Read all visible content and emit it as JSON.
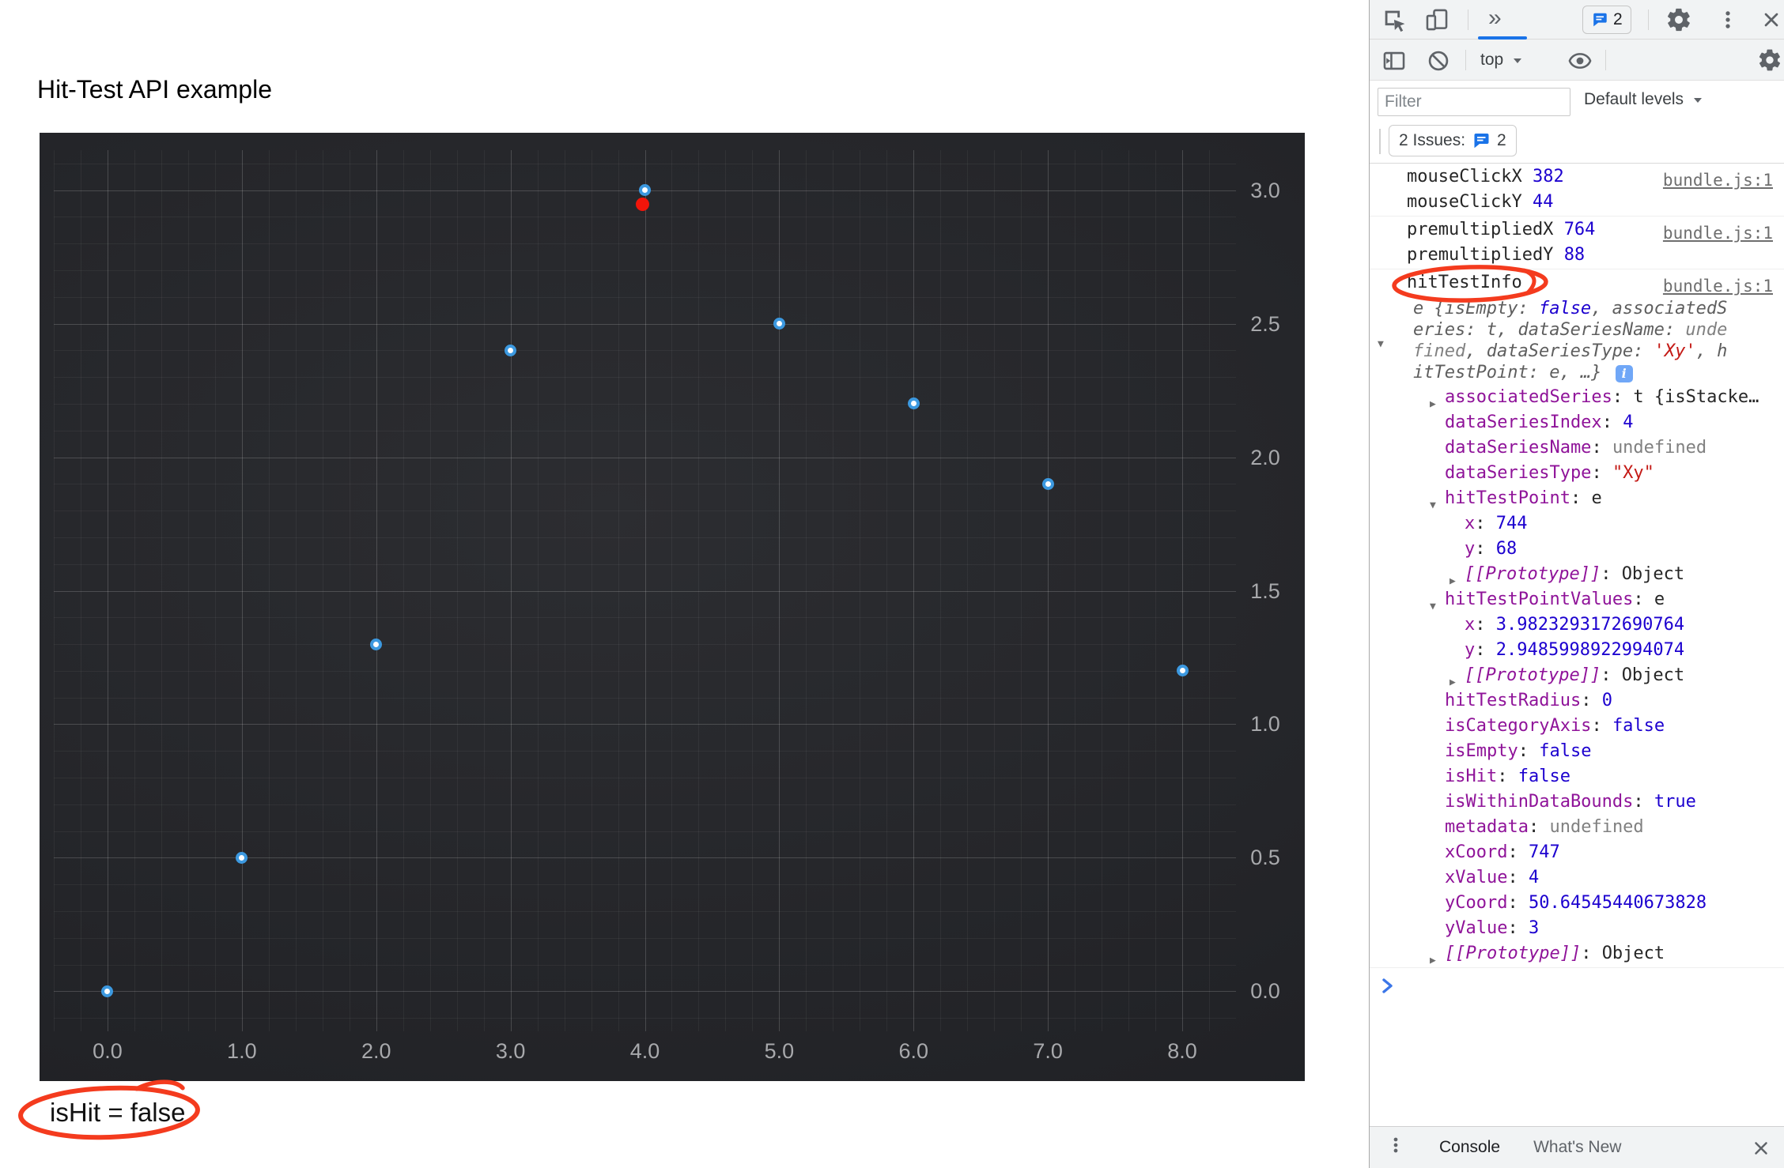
{
  "page": {
    "title": "Hit-Test API example",
    "hit_status": "isHit = false"
  },
  "chart_data": {
    "type": "scatter",
    "title": "",
    "xlabel": "",
    "ylabel": "",
    "x": [
      0,
      1,
      2,
      3,
      4,
      5,
      6,
      7,
      8
    ],
    "y": [
      0,
      0.5,
      1.3,
      2.4,
      3,
      2.5,
      2.2,
      1.9,
      1.2
    ],
    "highlight_point": {
      "x": 3.9823293172690764,
      "y": 2.9485998922994074,
      "color": "#F2150A"
    },
    "marker": {
      "stroke": "#3C99E0",
      "fill": "#FFFFFF"
    },
    "x_ticks": [
      {
        "v": 0,
        "label": "0.0"
      },
      {
        "v": 1,
        "label": "1.0"
      },
      {
        "v": 2,
        "label": "2.0"
      },
      {
        "v": 3,
        "label": "3.0"
      },
      {
        "v": 4,
        "label": "4.0"
      },
      {
        "v": 5,
        "label": "5.0"
      },
      {
        "v": 6,
        "label": "6.0"
      },
      {
        "v": 7,
        "label": "7.0"
      },
      {
        "v": 8,
        "label": "8.0"
      }
    ],
    "y_ticks": [
      {
        "v": 3,
        "label": "3.0"
      },
      {
        "v": 2.5,
        "label": "2.5"
      },
      {
        "v": 2,
        "label": "2.0"
      },
      {
        "v": 1.5,
        "label": "1.5"
      },
      {
        "v": 1,
        "label": "1.0"
      },
      {
        "v": 0.5,
        "label": "0.5"
      },
      {
        "v": 0,
        "label": "0.0"
      }
    ],
    "x_range": [
      -0.4,
      8.4
    ],
    "y_range": [
      -0.15,
      3.15
    ],
    "minor_step": {
      "x": 0.2,
      "y": 0.1
    },
    "grid": "on",
    "legend": "none",
    "colors": {
      "grid_major": "rgba(255,255,255,0.13)",
      "grid_minor": "rgba(255,255,255,0.05)",
      "tick_label": "#A8A9AC"
    }
  },
  "annotation_color": "#F43B1E",
  "devtools": {
    "tabs_row": {
      "more_tabs": "»",
      "issues_count": "2"
    },
    "console_toolbar": {
      "context": "top"
    },
    "filter_row": {
      "placeholder": "Filter",
      "levels": "Default levels"
    },
    "issues_bar": {
      "label": "2 Issues:",
      "count": "2"
    },
    "console": {
      "prompt": ">",
      "entries": [
        {
          "source": "bundle.js:1",
          "rows": [
            {
              "i": "0",
              "seg": [
                [
                  "mouseClickX ",
                  "sp"
                ],
                [
                  "382",
                  "sn"
                ]
              ]
            },
            {
              "i": "0",
              "seg": [
                [
                  "mouseClickY ",
                  "sp"
                ],
                [
                  "44",
                  "sn"
                ]
              ]
            }
          ]
        },
        {
          "source": "bundle.js:1",
          "rows": [
            {
              "i": "0",
              "seg": [
                [
                  "premultipliedX ",
                  "sp"
                ],
                [
                  "764",
                  "sn"
                ]
              ]
            },
            {
              "i": "0",
              "seg": [
                [
                  "premultipliedY ",
                  "sp"
                ],
                [
                  "88",
                  "sn"
                ]
              ]
            }
          ]
        },
        {
          "source": "bundle.js:1",
          "annotated": true,
          "rows": [
            {
              "i": "0",
              "name": "hit-test-info-label",
              "seg": [
                [
                  "hitTestInfo",
                  "sp"
                ]
              ]
            },
            {
              "i": "p",
              "arrow": "v",
              "seg": [
                [
                  "e {isEmpty: ",
                  "sg"
                ],
                [
                  "false",
                  "sb"
                ],
                [
                  ", associatedSeries: ",
                  "sg"
                ],
                [
                  "t",
                  "sg"
                ],
                [
                  ", dataSeriesName: ",
                  "sg"
                ],
                [
                  "undefined",
                  "su"
                ],
                [
                  ", dataSeriesType: ",
                  "sg"
                ],
                [
                  "'Xy'",
                  "ss"
                ],
                [
                  ", hitTestPoint: ",
                  "sg"
                ],
                [
                  "e",
                  "sg"
                ],
                [
                  ", …} ",
                  "sg"
                ],
                [
                  "i",
                  "icon"
                ]
              ]
            },
            {
              "i": "1",
              "arrow": "r",
              "seg": [
                [
                  "associatedSeries",
                  "sk"
                ],
                [
                  ": ",
                  "sp"
                ],
                [
                  "t {isStacke…",
                  "sp"
                ]
              ]
            },
            {
              "i": "1",
              "seg": [
                [
                  "dataSeriesIndex",
                  "sk"
                ],
                [
                  ": ",
                  "sp"
                ],
                [
                  "4",
                  "sn"
                ]
              ]
            },
            {
              "i": "1",
              "seg": [
                [
                  "dataSeriesName",
                  "sk"
                ],
                [
                  ": ",
                  "sp"
                ],
                [
                  "undefined",
                  "su"
                ]
              ]
            },
            {
              "i": "1",
              "seg": [
                [
                  "dataSeriesType",
                  "sk"
                ],
                [
                  ": ",
                  "sp"
                ],
                [
                  "\"Xy\"",
                  "ss"
                ]
              ]
            },
            {
              "i": "1",
              "arrow": "v",
              "seg": [
                [
                  "hitTestPoint",
                  "sk"
                ],
                [
                  ": ",
                  "sp"
                ],
                [
                  "e",
                  "sp"
                ]
              ]
            },
            {
              "i": "2",
              "seg": [
                [
                  "x",
                  "sk"
                ],
                [
                  ": ",
                  "sp"
                ],
                [
                  "744",
                  "sn"
                ]
              ]
            },
            {
              "i": "2",
              "seg": [
                [
                  "y",
                  "sk"
                ],
                [
                  ": ",
                  "sp"
                ],
                [
                  "68",
                  "sn"
                ]
              ]
            },
            {
              "i": "2",
              "arrow": "r",
              "seg": [
                [
                  "[[Prototype]]",
                  "ski"
                ],
                [
                  ": ",
                  "sp"
                ],
                [
                  "Object",
                  "sp"
                ]
              ]
            },
            {
              "i": "1",
              "arrow": "v",
              "seg": [
                [
                  "hitTestPointValues",
                  "sk"
                ],
                [
                  ": ",
                  "sp"
                ],
                [
                  "e",
                  "sp"
                ]
              ]
            },
            {
              "i": "2",
              "seg": [
                [
                  "x",
                  "sk"
                ],
                [
                  ": ",
                  "sp"
                ],
                [
                  "3.9823293172690764",
                  "sn"
                ]
              ]
            },
            {
              "i": "2",
              "seg": [
                [
                  "y",
                  "sk"
                ],
                [
                  ": ",
                  "sp"
                ],
                [
                  "2.9485998922994074",
                  "sn"
                ]
              ]
            },
            {
              "i": "2",
              "arrow": "r",
              "seg": [
                [
                  "[[Prototype]]",
                  "ski"
                ],
                [
                  ": ",
                  "sp"
                ],
                [
                  "Object",
                  "sp"
                ]
              ]
            },
            {
              "i": "1",
              "seg": [
                [
                  "hitTestRadius",
                  "sk"
                ],
                [
                  ": ",
                  "sp"
                ],
                [
                  "0",
                  "sn"
                ]
              ]
            },
            {
              "i": "1",
              "seg": [
                [
                  "isCategoryAxis",
                  "sk"
                ],
                [
                  ": ",
                  "sp"
                ],
                [
                  "false",
                  "sb"
                ]
              ]
            },
            {
              "i": "1",
              "seg": [
                [
                  "isEmpty",
                  "sk"
                ],
                [
                  ": ",
                  "sp"
                ],
                [
                  "false",
                  "sb"
                ]
              ]
            },
            {
              "i": "1",
              "seg": [
                [
                  "isHit",
                  "sk"
                ],
                [
                  ": ",
                  "sp"
                ],
                [
                  "false",
                  "sb"
                ]
              ]
            },
            {
              "i": "1",
              "seg": [
                [
                  "isWithinDataBounds",
                  "sk"
                ],
                [
                  ": ",
                  "sp"
                ],
                [
                  "true",
                  "sb"
                ]
              ]
            },
            {
              "i": "1",
              "seg": [
                [
                  "metadata",
                  "sk"
                ],
                [
                  ": ",
                  "sp"
                ],
                [
                  "undefined",
                  "su"
                ]
              ]
            },
            {
              "i": "1",
              "seg": [
                [
                  "xCoord",
                  "sk"
                ],
                [
                  ": ",
                  "sp"
                ],
                [
                  "747",
                  "sn"
                ]
              ]
            },
            {
              "i": "1",
              "seg": [
                [
                  "xValue",
                  "sk"
                ],
                [
                  ": ",
                  "sp"
                ],
                [
                  "4",
                  "sn"
                ]
              ]
            },
            {
              "i": "1",
              "seg": [
                [
                  "yCoord",
                  "sk"
                ],
                [
                  ": ",
                  "sp"
                ],
                [
                  "50.64545440673828",
                  "sn"
                ]
              ]
            },
            {
              "i": "1",
              "seg": [
                [
                  "yValue",
                  "sk"
                ],
                [
                  ": ",
                  "sp"
                ],
                [
                  "3",
                  "sn"
                ]
              ]
            },
            {
              "i": "1",
              "arrow": "r",
              "seg": [
                [
                  "[[Prototype]]",
                  "ski"
                ],
                [
                  ": ",
                  "sp"
                ],
                [
                  "Object",
                  "sp"
                ]
              ]
            }
          ]
        }
      ]
    },
    "drawer": {
      "tab_console": "Console",
      "tab_whats_new": "What's New"
    }
  }
}
